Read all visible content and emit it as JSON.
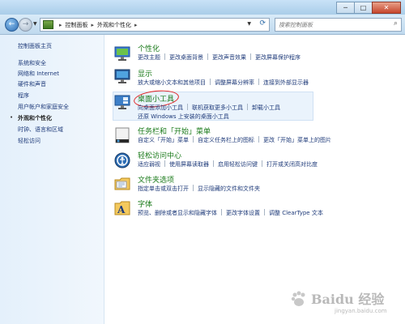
{
  "window": {
    "controls": {
      "minimize": "─",
      "maximize": "□",
      "close": "✕"
    }
  },
  "address": {
    "breadcrumbs": [
      "控制面板",
      "外观和个性化"
    ],
    "separator": "▸",
    "search_placeholder": "搜索控制面板"
  },
  "sidebar": {
    "items": [
      {
        "label": "控制面板主页",
        "current": false
      },
      {
        "label": "系统和安全",
        "current": false
      },
      {
        "label": "网络和 Internet",
        "current": false
      },
      {
        "label": "硬件和声音",
        "current": false
      },
      {
        "label": "程序",
        "current": false
      },
      {
        "label": "用户帐户和家庭安全",
        "current": false
      },
      {
        "label": "外观和个性化",
        "current": true
      },
      {
        "label": "时钟、语言和区域",
        "current": false
      },
      {
        "label": "轻松访问",
        "current": false
      }
    ]
  },
  "categories": [
    {
      "title": "个性化",
      "icon": "personalization-icon",
      "links": [
        [
          "更改主题",
          "更改桌面背景",
          "更改声音效果",
          "更改屏幕保护程序"
        ]
      ]
    },
    {
      "title": "显示",
      "icon": "display-icon",
      "links": [
        [
          "放大或缩小文本和其他项目",
          "调整屏幕分辨率",
          "连接到外部显示器"
        ]
      ]
    },
    {
      "title": "桌面小工具",
      "icon": "gadgets-icon",
      "links": [
        [
          "向桌面添加小工具",
          "联机获取更多小工具",
          "卸载小工具"
        ],
        [
          "还原 Windows 上安装的桌面小工具"
        ]
      ]
    },
    {
      "title": "任务栏和「开始」菜单",
      "icon": "taskbar-icon",
      "links": [
        [
          "自定义「开始」菜单",
          "自定义任务栏上的图标",
          "更改「开始」菜单上的图片"
        ]
      ]
    },
    {
      "title": "轻松访问中心",
      "icon": "ease-of-access-icon",
      "links": [
        [
          "适应弱视",
          "使用屏幕读取器",
          "启用轻松访问键",
          "打开或关闭高对比度"
        ]
      ]
    },
    {
      "title": "文件夹选项",
      "icon": "folder-options-icon",
      "links": [
        [
          "指定单击或双击打开",
          "显示隐藏的文件和文件夹"
        ]
      ]
    },
    {
      "title": "字体",
      "icon": "fonts-icon",
      "links": [
        [
          "预览、删除或者显示和隐藏字体",
          "更改字体设置",
          "调整 ClearType 文本"
        ]
      ]
    }
  ],
  "watermark": {
    "main": "Baidu 经验",
    "sub": "jingyan.baidu.com"
  },
  "colors": {
    "link": "#1e3a79",
    "category_title": "#1a7a1a",
    "annotation": "#e02020"
  }
}
